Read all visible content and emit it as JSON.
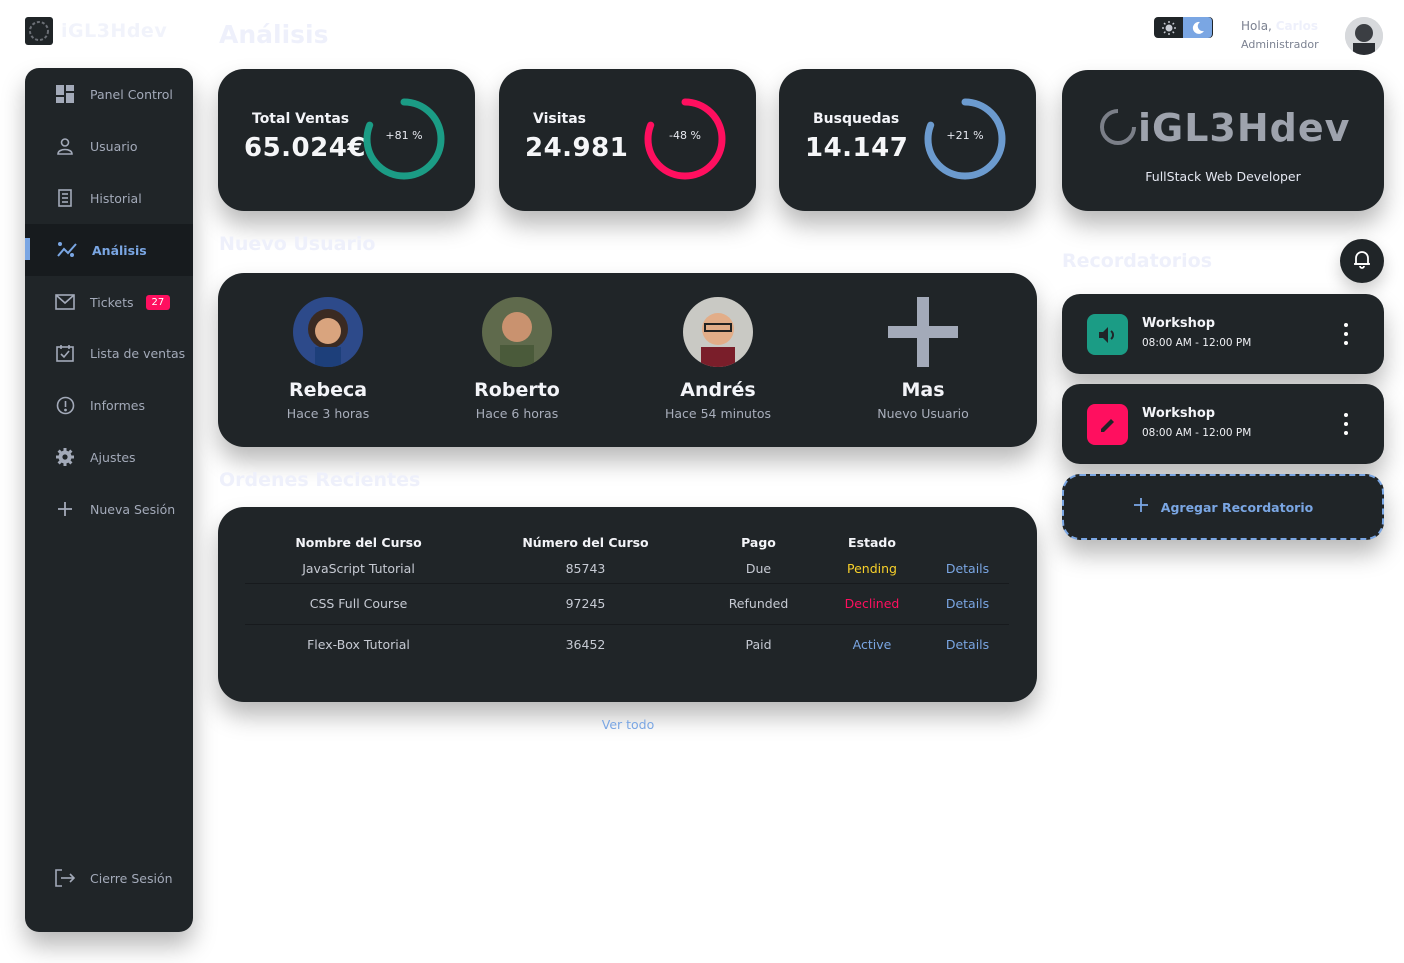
{
  "brand": {
    "name": "iGL3Hdev"
  },
  "page": {
    "title": "Análisis"
  },
  "sidebar": {
    "items": [
      {
        "label": "Panel Control",
        "icon": "dashboard-icon"
      },
      {
        "label": "Usuario",
        "icon": "user-icon"
      },
      {
        "label": "Historial",
        "icon": "receipt-icon"
      },
      {
        "label": "Análisis",
        "icon": "analytics-icon",
        "active": true
      },
      {
        "label": "Tickets",
        "icon": "mail-icon",
        "badge": "27"
      },
      {
        "label": "Lista de ventas",
        "icon": "calendar-check-icon"
      },
      {
        "label": "Informes",
        "icon": "alert-circle-icon"
      },
      {
        "label": "Ajustes",
        "icon": "gear-icon"
      },
      {
        "label": "Nueva Sesión",
        "icon": "plus-icon"
      }
    ],
    "logout": {
      "label": "Cierre Sesión",
      "icon": "logout-icon"
    }
  },
  "stats": [
    {
      "title": "Total Ventas",
      "value": "65.024€",
      "pct": "+81 %",
      "progress": 0.81,
      "color": "#1b9c85"
    },
    {
      "title": "Visitas",
      "value": "24.981",
      "pct": "-48 %",
      "progress": 0.81,
      "color": "#ff0f5f"
    },
    {
      "title": "Busquedas",
      "value": "14.147",
      "pct": "+21 %",
      "progress": 0.81,
      "color": "#6c9bcf"
    }
  ],
  "brand_card": {
    "logo_text": "iGL3Hdev",
    "subtitle": "FullStack Web Developer"
  },
  "new_users": {
    "title": "Nuevo Usuario",
    "users": [
      {
        "name": "Rebeca",
        "time": "Hace 3 horas"
      },
      {
        "name": "Roberto",
        "time": "Hace 6 horas"
      },
      {
        "name": "Andrés",
        "time": "Hace 54 minutos"
      },
      {
        "name": "Mas",
        "time": "Nuevo Usuario"
      }
    ]
  },
  "orders": {
    "title": "Ordenes Recientes",
    "headers": [
      "Nombre del Curso",
      "Número del Curso",
      "Pago",
      "Estado",
      ""
    ],
    "rows": [
      {
        "name": "JavaScript Tutorial",
        "number": "85743",
        "payment": "Due",
        "status": "Pending",
        "action": "Details"
      },
      {
        "name": "CSS Full Course",
        "number": "97245",
        "payment": "Refunded",
        "status": "Declined",
        "action": "Details"
      },
      {
        "name": "Flex-Box Tutorial",
        "number": "36452",
        "payment": "Paid",
        "status": "Active",
        "action": "Details"
      }
    ],
    "see_all": "Ver todo"
  },
  "header": {
    "greeting": "Hola,",
    "user_name": "Carlos",
    "role": "Administrador"
  },
  "reminders": {
    "title": "Recordatorios",
    "items": [
      {
        "title": "Workshop",
        "time": "08:00 AM - 12:00 PM",
        "icon": "volume-icon",
        "color": "#1b9c85"
      },
      {
        "title": "Workshop",
        "time": "08:00 AM - 12:00 PM",
        "icon": "pencil-icon",
        "color": "#ff0f5f"
      }
    ],
    "add_label": "Agregar Recordatorio"
  },
  "colors": {
    "accent": "#7aa6e3",
    "card": "#202528",
    "danger": "#ff0f5f",
    "warning": "#f7d02a",
    "success": "#1b9c85"
  }
}
